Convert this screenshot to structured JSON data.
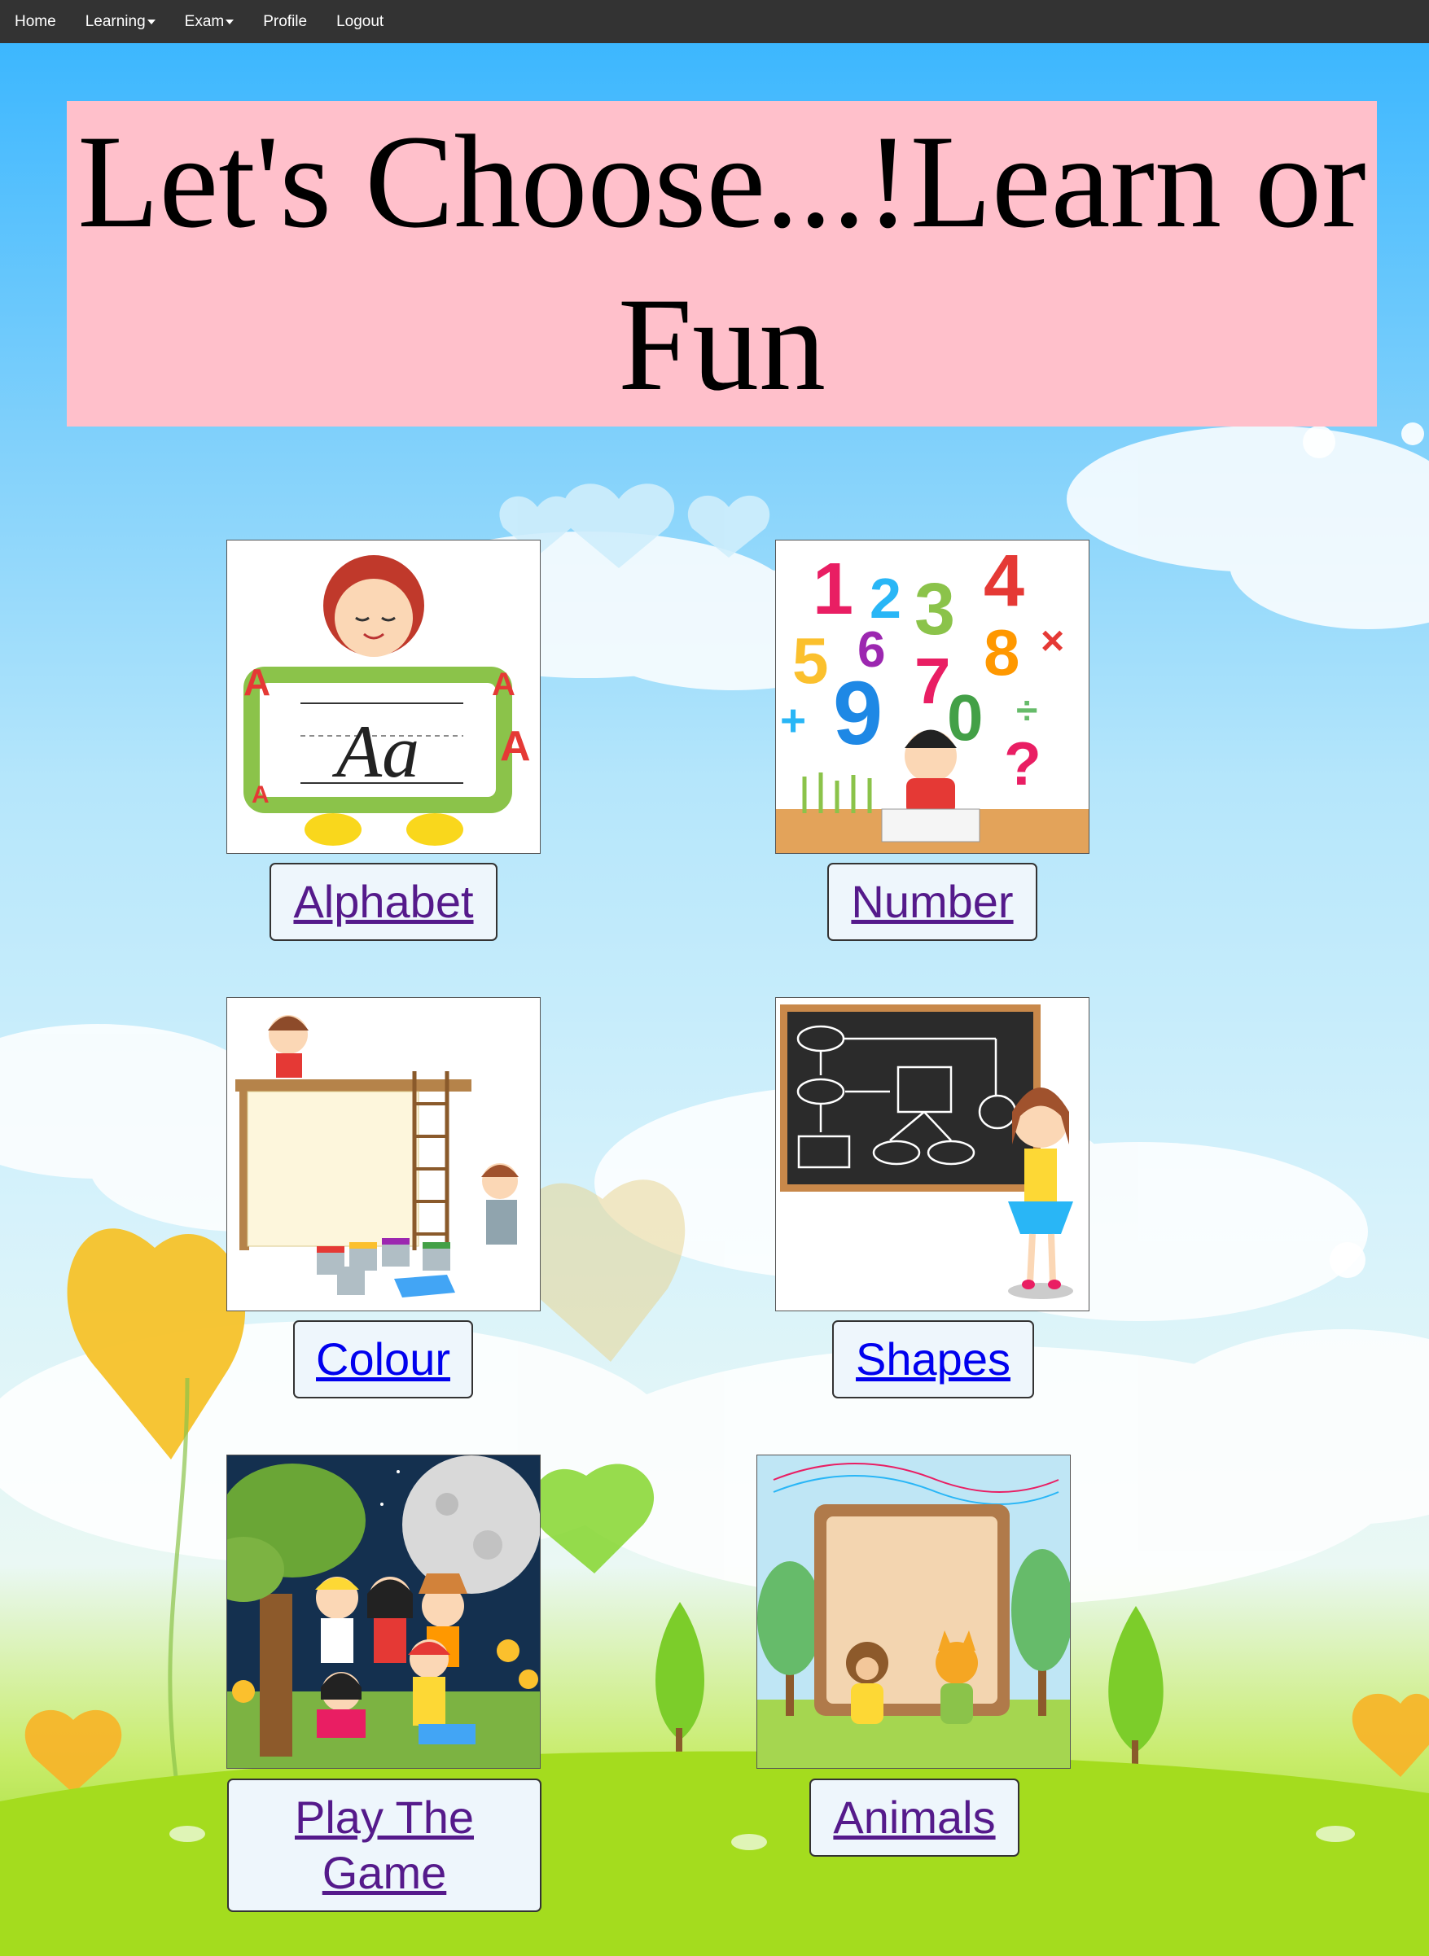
{
  "navbar": {
    "items": [
      {
        "label": "Home",
        "dropdown": false
      },
      {
        "label": "Learning",
        "dropdown": true
      },
      {
        "label": "Exam",
        "dropdown": true
      },
      {
        "label": "Profile",
        "dropdown": false
      },
      {
        "label": "Logout",
        "dropdown": false
      }
    ]
  },
  "banner": {
    "title": "Let's Choose...!Learn or Fun"
  },
  "tiles": {
    "alphabet": {
      "label": "Alphabet",
      "image": "girl-holding-alphabet-board-image"
    },
    "number": {
      "label": "Number",
      "image": "boy-with-colorful-numbers-image"
    },
    "colour": {
      "label": "Colour",
      "image": "kids-painting-canvas-image"
    },
    "shapes": {
      "label": "Shapes",
      "image": "girl-at-blackboard-shapes-image"
    },
    "play_game": {
      "label": "Play The Game",
      "image": "kids-under-moon-tree-image"
    },
    "animals": {
      "label": "Animals",
      "image": "animals-wooden-board-image"
    }
  },
  "colors": {
    "navbar_bg": "#333333",
    "banner_bg": "#ffc0cb",
    "visited_link": "#551a8b",
    "link": "#0000ee"
  }
}
